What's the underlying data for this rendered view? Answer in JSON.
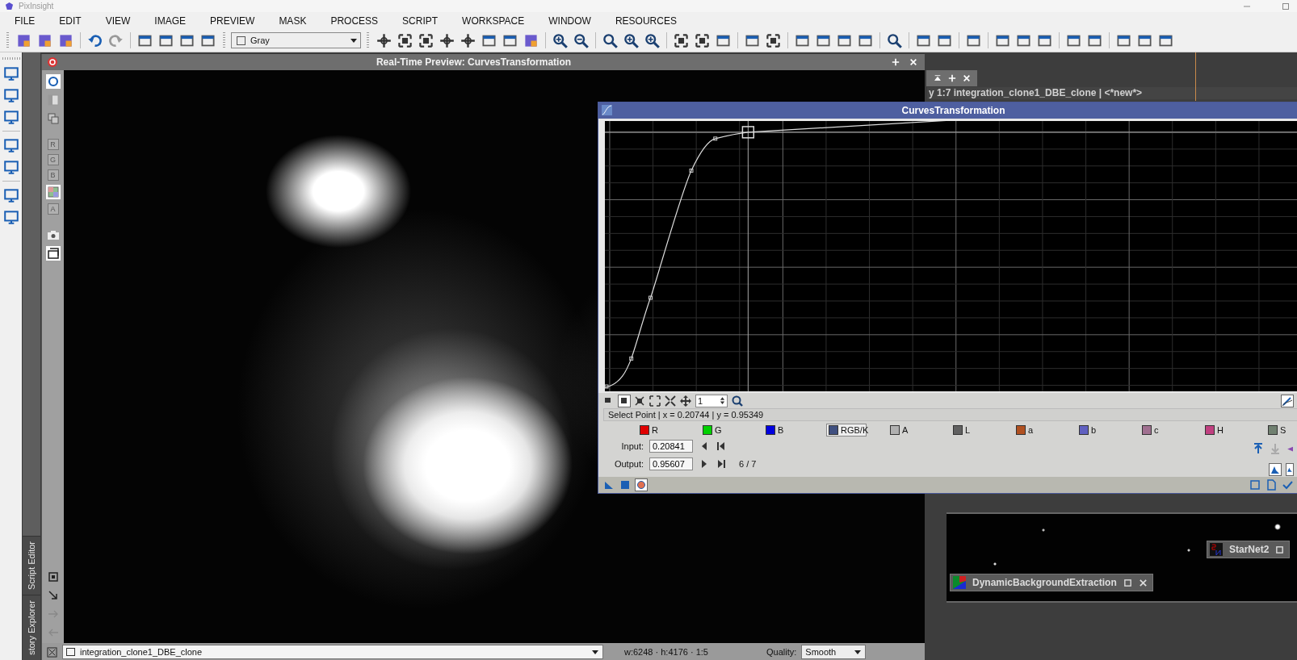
{
  "app": {
    "title": "PixInsight"
  },
  "menu": [
    {
      "label": "FILE"
    },
    {
      "label": "EDIT"
    },
    {
      "label": "VIEW"
    },
    {
      "label": "IMAGE"
    },
    {
      "label": "PREVIEW"
    },
    {
      "label": "MASK"
    },
    {
      "label": "PROCESS"
    },
    {
      "label": "SCRIPT"
    },
    {
      "label": "WORKSPACE"
    },
    {
      "label": "WINDOW"
    },
    {
      "label": "RESOURCES"
    }
  ],
  "toolbar": {
    "view_mode": "Gray"
  },
  "side_tabs": [
    {
      "label": "Script Editor"
    },
    {
      "label": "story Explorer"
    }
  ],
  "preview": {
    "title": "Real-Time Preview: CurvesTransformation",
    "view": "integration_clone1_DBE_clone",
    "dimensions": "w:6248 · h:4176 · 1:5",
    "quality_label": "Quality:",
    "quality": "Smooth",
    "channel_buttons": [
      {
        "kind": "letter",
        "label": "R",
        "selected": false
      },
      {
        "kind": "letter",
        "label": "G",
        "selected": false
      },
      {
        "kind": "letter",
        "label": "B",
        "selected": false
      },
      {
        "kind": "swatch",
        "selected": true
      },
      {
        "kind": "letter",
        "label": "A",
        "selected": false
      }
    ]
  },
  "image_window": {
    "title": "y 1:7 integration_clone1_DBE_clone | <*new*>"
  },
  "curves": {
    "title": "CurvesTransformation",
    "zoom": "1",
    "status": "Select Point | x = 0.20744 | y = 0.95349",
    "channels": [
      {
        "label": "R",
        "color": "#e00000",
        "selected": false
      },
      {
        "label": "G",
        "color": "#00d000",
        "selected": false
      },
      {
        "label": "B",
        "color": "#0000e0",
        "selected": false
      },
      {
        "label": "RGB/K",
        "color": "#405080",
        "selected": true
      },
      {
        "label": "A",
        "color": "#b0b0b0",
        "selected": false
      },
      {
        "label": "L",
        "color": "#606060",
        "selected": false
      },
      {
        "label": "a",
        "color": "#b05020",
        "selected": false
      },
      {
        "label": "b",
        "color": "#6060c0",
        "selected": false
      },
      {
        "label": "c",
        "color": "#a07090",
        "selected": false
      },
      {
        "label": "H",
        "color": "#c04080",
        "selected": false
      },
      {
        "label": "S",
        "color": "#708070",
        "selected": false
      }
    ],
    "input_label": "Input:",
    "input": "0.20841",
    "output_label": "Output:",
    "output": "0.95607",
    "point_index": "6 / 7"
  },
  "process_icons": [
    {
      "label": "StarNet2"
    },
    {
      "label": "DynamicBackgroundExtraction"
    }
  ]
}
